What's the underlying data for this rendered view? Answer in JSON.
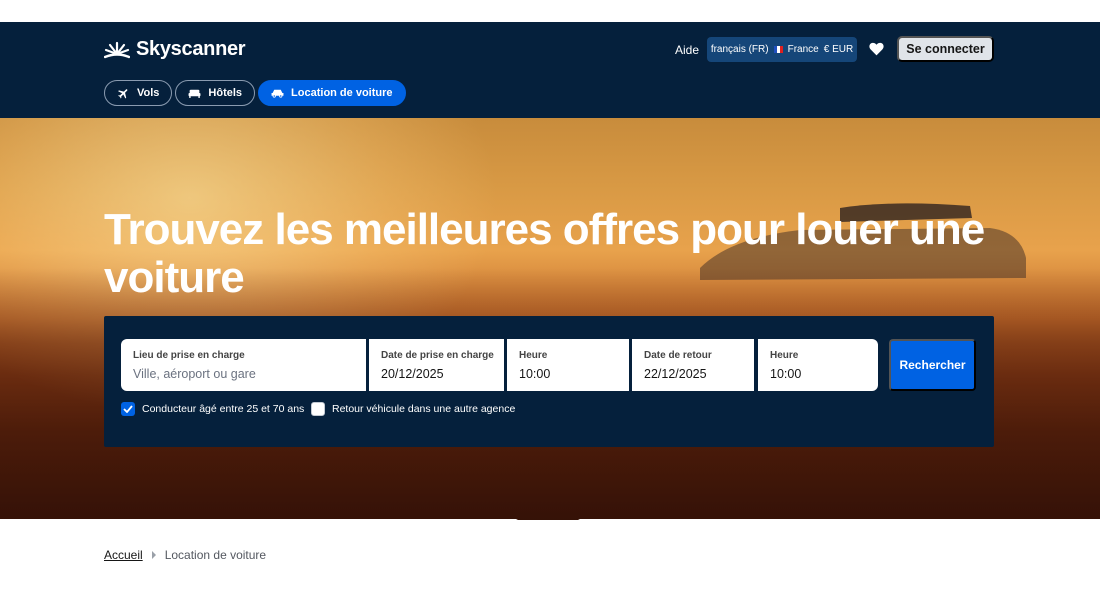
{
  "brand": {
    "name": "Skyscanner"
  },
  "header": {
    "help_label": "Aide",
    "locale": {
      "language": "français (FR)",
      "country": "France",
      "currency": "€ EUR"
    },
    "login_label": "Se connecter"
  },
  "tabs": [
    {
      "label": "Vols",
      "icon": "plane-icon",
      "active": false
    },
    {
      "label": "Hôtels",
      "icon": "bed-icon",
      "active": false
    },
    {
      "label": "Location de voiture",
      "icon": "car-icon",
      "active": true
    }
  ],
  "hero": {
    "headline": "Trouvez les meilleures offres pour louer une voiture"
  },
  "search": {
    "pickup": {
      "label": "Lieu de prise en charge",
      "placeholder": "Ville, aéroport ou gare"
    },
    "pickup_date": {
      "label": "Date de prise en charge",
      "value": "20/12/2025"
    },
    "pickup_time": {
      "label": "Heure",
      "value": "10:00"
    },
    "return_date": {
      "label": "Date de retour",
      "value": "22/12/2025"
    },
    "return_time": {
      "label": "Heure",
      "value": "10:00"
    },
    "submit_label": "Rechercher",
    "options": [
      {
        "label": "Conducteur âgé entre 25 et 70 ans",
        "checked": true
      },
      {
        "label": "Retour véhicule dans une autre agence",
        "checked": false
      }
    ]
  },
  "breadcrumb": {
    "home": "Accueil",
    "current": "Location de voiture"
  },
  "colors": {
    "navy": "#05203c",
    "blue": "#0062e3",
    "locale_bg": "#154679"
  }
}
